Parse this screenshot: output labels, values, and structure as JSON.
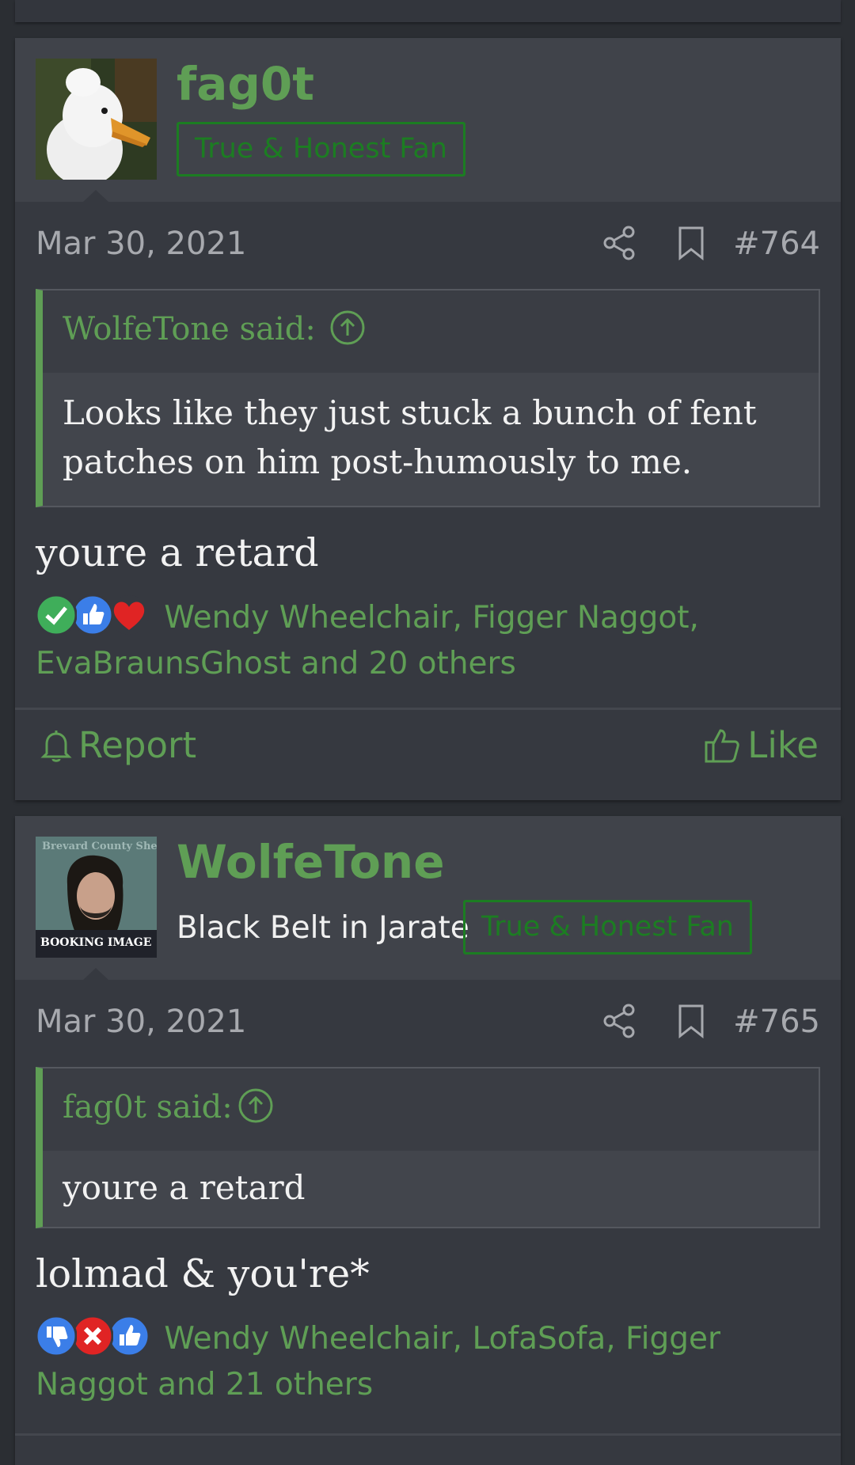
{
  "posts": [
    {
      "username": "fag0t",
      "user_title": "",
      "badge": "True & Honest Fan",
      "date": "Mar 30, 2021",
      "post_number": "#764",
      "quote": {
        "author": "WolfeTone said:",
        "text": "Looks like they just stuck a bunch of fent patches on him post-humously to me."
      },
      "body": "youre a retard",
      "reaction_icons": [
        "check-icon",
        "thumbs-up-icon",
        "heart-icon"
      ],
      "reactions_text": "Wendy Wheelchair, Figger Naggot, EvaBraunsGhost and 20 others",
      "report_label": "Report",
      "like_label": "Like"
    },
    {
      "username": "WolfeTone",
      "user_title": "Black Belt in Jarate",
      "badge": "True & Honest Fan",
      "avatar_text": "BOOKING IMAGE",
      "avatar_header": "Brevard County Sheriff's Office",
      "date": "Mar 30, 2021",
      "post_number": "#765",
      "quote": {
        "author": "fag0t said:",
        "text": "youre a retard"
      },
      "body": "lolmad & you're*",
      "reaction_icons": [
        "thumbs-down-icon",
        "x-icon",
        "thumbs-up-icon"
      ],
      "reactions_text": "Wendy Wheelchair, LofaSofa, Figger Naggot and 21 others"
    }
  ],
  "colors": {
    "accent_green": "#5f9e55",
    "badge_green": "#1c7d22",
    "background": "#2b2e33",
    "card": "#363940"
  }
}
